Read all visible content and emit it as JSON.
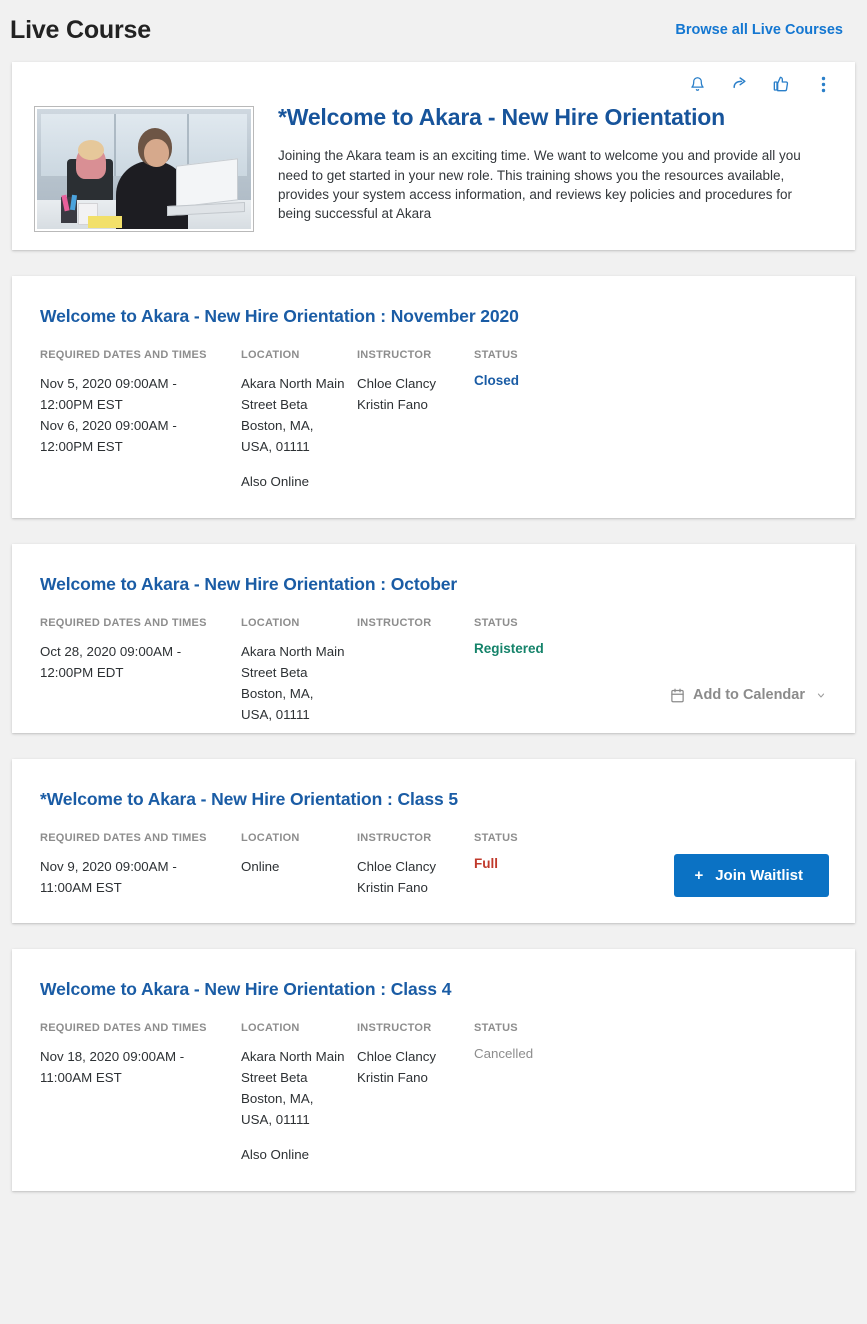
{
  "header": {
    "title": "Live Course",
    "browse_link": "Browse all Live Courses"
  },
  "hero": {
    "actions": [
      {
        "name": "notify-icon",
        "label": "Notify"
      },
      {
        "name": "share-icon",
        "label": "Share"
      },
      {
        "name": "thumbs-up-icon",
        "label": "Like"
      },
      {
        "name": "more-options-icon",
        "label": "More options"
      }
    ],
    "thumbnail_alt": "Woman working on a laptop in an office",
    "title": "*Welcome to Akara - New Hire Orientation",
    "description": "Joining the Akara team is an exciting time. We want to welcome you and provide all you need to get started in your new role. This training shows you the resources available, provides your system access information, and reviews key policies and procedures for being successful at Akara"
  },
  "columns": {
    "dates": "REQUIRED DATES AND TIMES",
    "location": "LOCATION",
    "instructor": "INSTRUCTOR",
    "status": "STATUS"
  },
  "sessions": [
    {
      "title": "Welcome to Akara - New Hire Orientation : November 2020",
      "dates": [
        "Nov 5, 2020 09:00AM - 12:00PM EST",
        "Nov 6, 2020 09:00AM - 12:00PM EST"
      ],
      "location": "Akara North Main Street Beta Boston, MA, USA, 01111",
      "location_extra": "Also Online",
      "instructors": [
        "Chloe Clancy",
        "Kristin Fano"
      ],
      "status": "Closed",
      "status_color": "#1a5ca5",
      "action": null
    },
    {
      "title": "Welcome to Akara - New Hire Orientation : October",
      "dates": [
        "Oct 28, 2020 09:00AM - 12:00PM EDT"
      ],
      "location": "Akara North Main Street Beta Boston, MA, USA, 01111",
      "location_extra": "",
      "instructors": [],
      "status": "Registered",
      "status_color": "#15836a",
      "action": {
        "type": "add-to-calendar",
        "label": "Add to Calendar"
      }
    },
    {
      "title": "*Welcome to Akara - New Hire Orientation : Class 5",
      "dates": [
        "Nov 9, 2020 09:00AM - 11:00AM EST"
      ],
      "location": "Online",
      "location_extra": "",
      "instructors": [
        "Chloe Clancy",
        "Kristin Fano"
      ],
      "status": "Full",
      "status_color": "#c0392b",
      "action": {
        "type": "join-waitlist",
        "label": "Join Waitlist",
        "plus": "+"
      }
    },
    {
      "title": "Welcome to Akara - New Hire Orientation : Class 4",
      "dates": [
        "Nov 18, 2020 09:00AM - 11:00AM EST"
      ],
      "location": "Akara North Main Street Beta Boston, MA, USA, 01111",
      "location_extra": "Also Online",
      "instructors": [
        "Chloe Clancy",
        "Kristin Fano"
      ],
      "status": "Cancelled",
      "status_color": "#8d8d8d",
      "action": null
    }
  ]
}
